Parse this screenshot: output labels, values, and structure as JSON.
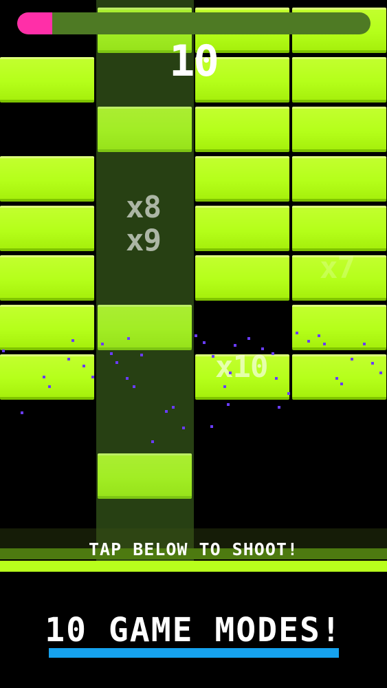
{
  "hud": {
    "score": "10",
    "progress_fraction": 0.1,
    "progress_color": "#ff2fa8"
  },
  "bricks": [
    {
      "col": 1,
      "row": 0
    },
    {
      "col": 2,
      "row": 0
    },
    {
      "col": 3,
      "row": 0
    },
    {
      "col": 0,
      "row": 1
    },
    {
      "col": 2,
      "row": 1
    },
    {
      "col": 3,
      "row": 1
    },
    {
      "col": 1,
      "row": 2
    },
    {
      "col": 2,
      "row": 2
    },
    {
      "col": 3,
      "row": 2
    },
    {
      "col": 0,
      "row": 3
    },
    {
      "col": 2,
      "row": 3
    },
    {
      "col": 3,
      "row": 3
    },
    {
      "col": 0,
      "row": 4
    },
    {
      "col": 2,
      "row": 4
    },
    {
      "col": 3,
      "row": 4
    },
    {
      "col": 0,
      "row": 5
    },
    {
      "col": 2,
      "row": 5
    },
    {
      "col": 3,
      "row": 5
    },
    {
      "col": 0,
      "row": 6
    },
    {
      "col": 1,
      "row": 6
    },
    {
      "col": 3,
      "row": 6
    },
    {
      "col": 0,
      "row": 7
    },
    {
      "col": 2,
      "row": 7
    },
    {
      "col": 3,
      "row": 7
    },
    {
      "col": 1,
      "row": 9
    }
  ],
  "multipliers": {
    "m1": "x8",
    "m2": "x9",
    "m3": "x10",
    "m4": "x7"
  },
  "shoot_hint": "TAP BELOW TO SHOOT!",
  "promo": {
    "title": "10 GAME MODES!",
    "accent_color": "#16a2ee"
  },
  "colors": {
    "brick": "#b5ff1a",
    "particle": "#6a3cff",
    "background": "#000000"
  }
}
